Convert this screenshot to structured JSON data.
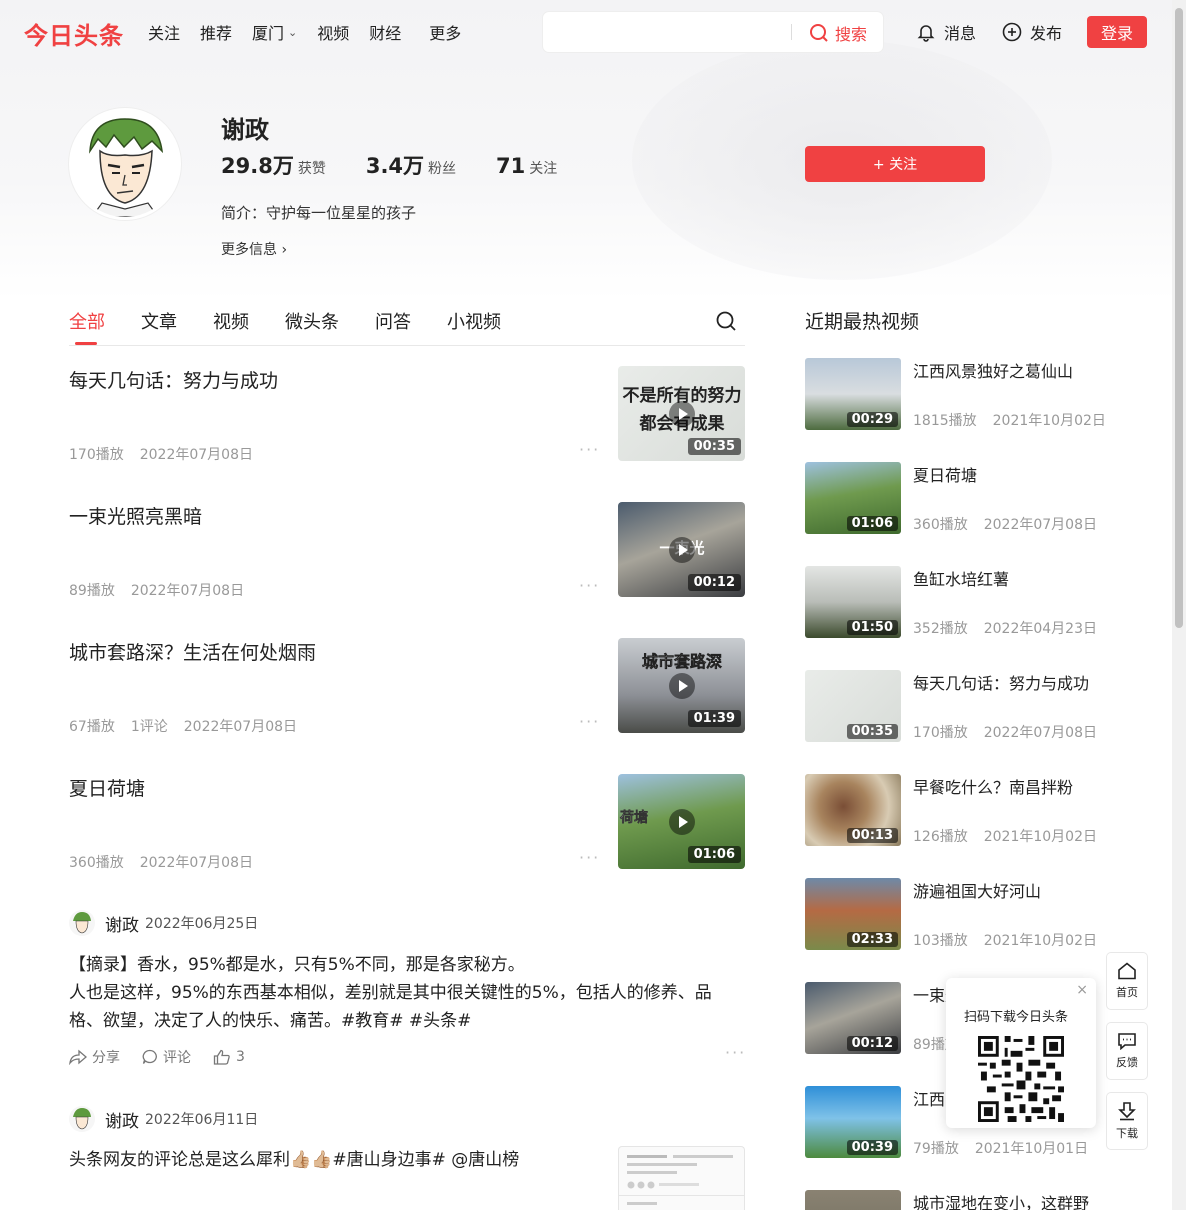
{
  "header": {
    "logo": "今日头条",
    "nav": [
      "关注",
      "推荐",
      "厦门",
      "视频",
      "财经",
      "更多"
    ],
    "search_placeholder": "",
    "search_button": "搜索",
    "messages": "消息",
    "publish": "发布",
    "login": "登录"
  },
  "profile": {
    "name": "谢政",
    "stats": [
      {
        "num": "29.8万",
        "label": "获赞"
      },
      {
        "num": "3.4万",
        "label": "粉丝"
      },
      {
        "num": "71",
        "label": "关注"
      }
    ],
    "bio": "简介：守护每一位星星的孩子",
    "more_info": "更多信息 ›",
    "follow_button": "+ 关注"
  },
  "tabs": [
    "全部",
    "文章",
    "视频",
    "微头条",
    "问答",
    "小视频"
  ],
  "feed_videos": [
    {
      "title": "每天几句话：努力与成功",
      "plays": "170播放",
      "comments": "",
      "date": "2022年07月08日",
      "duration": "00:35",
      "caption": "不是所有的努力都会有成果"
    },
    {
      "title": "一束光照亮黑暗",
      "plays": "89播放",
      "comments": "",
      "date": "2022年07月08日",
      "duration": "00:12",
      "caption": "一束光"
    },
    {
      "title": "城市套路深？生活在何处烟雨",
      "plays": "67播放",
      "comments": "1评论",
      "date": "2022年07月08日",
      "duration": "01:39",
      "caption": "城市套路深"
    },
    {
      "title": "夏日荷塘",
      "plays": "360播放",
      "comments": "",
      "date": "2022年07月08日",
      "duration": "01:06",
      "caption": "荷塘"
    }
  ],
  "posts": [
    {
      "author": "谢政",
      "date": "2022年06月25日",
      "lines": [
        "【摘录】香水，95%都是水，只有5%不同，那是各家秘方。",
        "人也是这样，95%的东西基本相似，差别就是其中很关键性的5%，包括人的修养、品",
        "格、欲望，决定了人的快乐、痛苦。#教育# #头条#"
      ],
      "share": "分享",
      "comment": "评论",
      "likes": "3"
    },
    {
      "author": "谢政",
      "date": "2022年06月11日",
      "text": "头条网友的评论总是这么犀利👍🏼👍🏼#唐山身边事# @唐山榜"
    }
  ],
  "right": {
    "title": "近期最热视频",
    "videos": [
      {
        "title": "江西风景独好之葛仙山",
        "plays": "1815播放",
        "date": "2021年10月02日",
        "duration": "00:29"
      },
      {
        "title": "夏日荷塘",
        "plays": "360播放",
        "date": "2022年07月08日",
        "duration": "01:06"
      },
      {
        "title": "鱼缸水培红薯",
        "plays": "352播放",
        "date": "2022年04月23日",
        "duration": "01:50"
      },
      {
        "title": "每天几句话：努力与成功",
        "plays": "170播放",
        "date": "2022年07月08日",
        "duration": "00:35"
      },
      {
        "title": "早餐吃什么？南昌拌粉",
        "plays": "126播放",
        "date": "2021年10月02日",
        "duration": "00:13"
      },
      {
        "title": "游遍祖国大好河山",
        "plays": "103播放",
        "date": "2021年10月02日",
        "duration": "02:33"
      },
      {
        "title": "一束光",
        "plays": "89播放",
        "date": "",
        "duration": "00:12"
      },
      {
        "title": "江西",
        "plays": "79播放",
        "date": "2021年10月01日",
        "duration": "00:39"
      },
      {
        "title": "城市湿地在变小，这群野",
        "plays": "",
        "date": "",
        "duration": ""
      }
    ]
  },
  "qr": {
    "title": "扫码下载今日头条",
    "close": "×"
  },
  "side": {
    "home": "首页",
    "feedback": "反馈",
    "download": "下载"
  }
}
